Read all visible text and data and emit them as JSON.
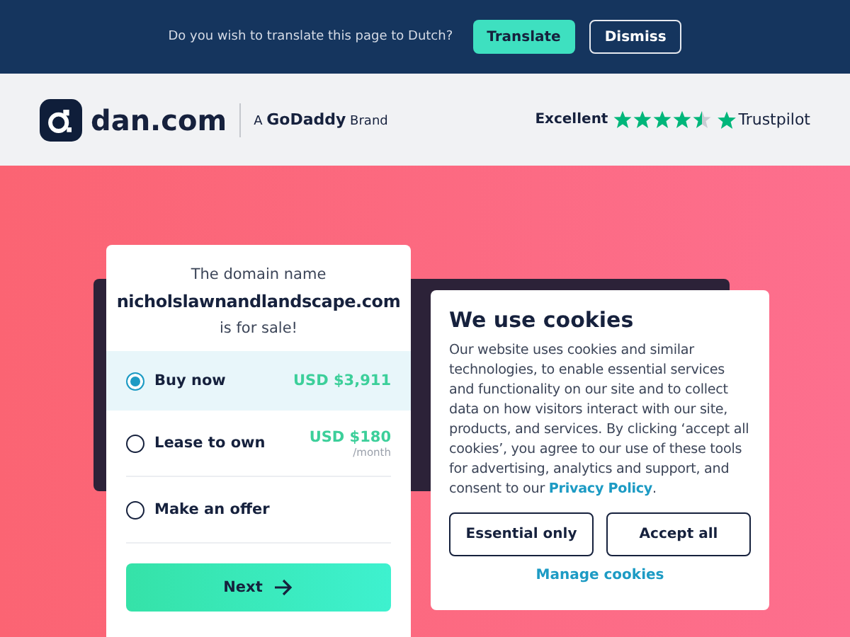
{
  "translate_bar": {
    "message": "Do you wish to translate this page to Dutch?",
    "buttons": [
      {
        "label": "Translate",
        "kind": "primary"
      },
      {
        "label": "Dismiss",
        "kind": "outline"
      }
    ]
  },
  "header": {
    "logo_text": "dan.com",
    "brand_prefix": "A",
    "brand_name": "GoDaddy",
    "brand_suffix": "Brand",
    "rating_label": "Excellent",
    "stars": 4.5,
    "review_site": "Trustpilot"
  },
  "sale_card": {
    "intro": "The domain name",
    "domain": "nicholslawnandlandscape.com",
    "outro": "is for sale!",
    "options": [
      {
        "label": "Buy now",
        "price": "USD $3,911",
        "selected": true
      },
      {
        "label": "Lease to own",
        "price": "USD $180",
        "note": "/month",
        "selected": false
      },
      {
        "label": "Make an offer",
        "selected": false
      }
    ],
    "next_button": "Next"
  },
  "cookie_dialog": {
    "title": "We use cookies",
    "body": "Our website uses cookies and similar technologies, to enable essential services and functionality on our site and to collect data on how visitors interact with our site, products, and services. By clicking ‘accept all cookies’, you agree to our use of these tools for advertising, analytics and support, and consent to our",
    "link": "Privacy Policy",
    "end": ".",
    "buttons": [
      "Essential only",
      "Accept all"
    ],
    "manage": "Manage cookies"
  }
}
